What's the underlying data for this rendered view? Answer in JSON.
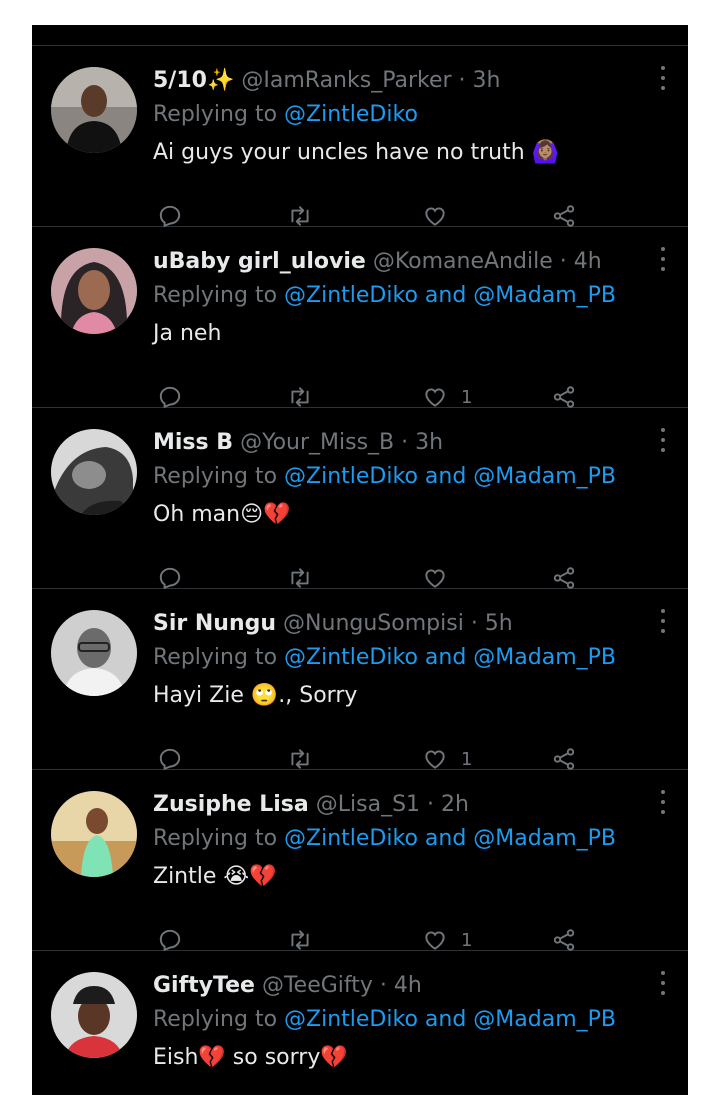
{
  "colors": {
    "background": "#000000",
    "text": "#e7e9ea",
    "muted": "#71767b",
    "link": "#1d9bf0",
    "divider": "#2f3336"
  },
  "icons": {
    "reply": "reply-icon",
    "retweet": "retweet-icon",
    "like": "heart-icon",
    "share": "share-icon",
    "more": "more-icon"
  },
  "tweets": [
    {
      "name": "5/10✨",
      "handle": "@IamRanks_Parker",
      "time": "· 3h",
      "replying_prefix": "Replying to ",
      "mention1": "@ZintleDiko",
      "and_text": "",
      "mention2": "",
      "text": "Ai guys your uncles have no truth 🙆🏽‍♀️",
      "likes": ""
    },
    {
      "name": "uBaby girl_ulovie",
      "handle": "@KomaneAndile",
      "time": "· 4h",
      "replying_prefix": "Replying to ",
      "mention1": "@ZintleDiko",
      "and_text": " and ",
      "mention2": "@Madam_PB",
      "text": "Ja neh",
      "likes": "1"
    },
    {
      "name": "Miss B",
      "handle": "@Your_Miss_B",
      "time": "· 3h",
      "replying_prefix": "Replying to ",
      "mention1": "@ZintleDiko",
      "and_text": " and ",
      "mention2": "@Madam_PB",
      "text": "Oh man😔💔",
      "likes": ""
    },
    {
      "name": "Sir Nungu",
      "handle": "@NunguSompisi",
      "time": "· 5h",
      "replying_prefix": "Replying to ",
      "mention1": "@ZintleDiko",
      "and_text": " and ",
      "mention2": "@Madam_PB",
      "text": "Hayi Zie 🙄., Sorry",
      "likes": "1"
    },
    {
      "name": "Zusiphe Lisa",
      "handle": "@Lisa_S1",
      "time": "· 2h",
      "replying_prefix": "Replying to ",
      "mention1": "@ZintleDiko",
      "and_text": " and ",
      "mention2": "@Madam_PB",
      "text": "Zintle 😭💔",
      "likes": "1"
    },
    {
      "name": "GiftyTee",
      "handle": "@TeeGifty",
      "time": "· 4h",
      "replying_prefix": "Replying to ",
      "mention1": "@ZintleDiko",
      "and_text": " and ",
      "mention2": "@Madam_PB",
      "text": "Eish💔 so sorry💔",
      "likes": ""
    }
  ]
}
